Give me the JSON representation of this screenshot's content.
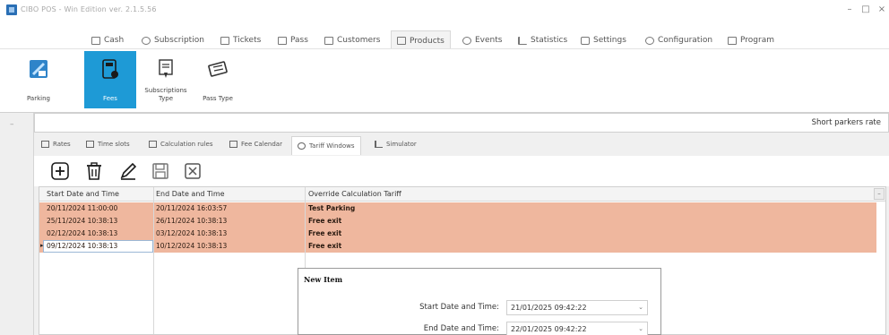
{
  "window": {
    "title": "CIBO POS - Win Edition ver. 2.1.5.56",
    "minimize": "–",
    "restore": "□",
    "close": "×"
  },
  "menu": {
    "items": [
      {
        "label": "Cash",
        "icon": "cash-register-icon"
      },
      {
        "label": "Subscription",
        "icon": "subscription-icon"
      },
      {
        "label": "Tickets",
        "icon": "ticket-icon"
      },
      {
        "label": "Pass",
        "icon": "pass-icon"
      },
      {
        "label": "Customers",
        "icon": "customers-icon"
      },
      {
        "label": "Products",
        "icon": "products-icon",
        "active": true
      },
      {
        "label": "Events",
        "icon": "events-icon"
      },
      {
        "label": "Statistics",
        "icon": "statistics-icon"
      },
      {
        "label": "Settings",
        "icon": "settings-icon"
      },
      {
        "label": "Configuration",
        "icon": "configuration-icon"
      },
      {
        "label": "Program",
        "icon": "program-icon"
      }
    ]
  },
  "ribbon": {
    "parking": "Parking",
    "fees": "Fees",
    "subscriptions_type": "Subscriptions Type",
    "pass_type": "Pass Type"
  },
  "rate": {
    "name": "Short parkers rate"
  },
  "subtabs": {
    "items": [
      {
        "label": "Rates"
      },
      {
        "label": "Time slots"
      },
      {
        "label": "Calculation rules"
      },
      {
        "label": "Fee Calendar"
      },
      {
        "label": "Tariff Windows",
        "active": true
      },
      {
        "label": "Simulator"
      }
    ]
  },
  "toolbar": {
    "add": "add",
    "delete": "delete",
    "edit": "edit",
    "save": "save",
    "cancel": "cancel"
  },
  "grid": {
    "columns": [
      "Start Date and Time",
      "End Date and Time",
      "Override Calculation Tariff"
    ],
    "rows": [
      {
        "start": "20/11/2024 11:00:00",
        "end": "20/11/2024 16:03:57",
        "tariff": "Test Parking"
      },
      {
        "start": "25/11/2024 10:38:13",
        "end": "26/11/2024 10:38:13",
        "tariff": "Free exit"
      },
      {
        "start": "02/12/2024 10:38:13",
        "end": "03/12/2024 10:38:13",
        "tariff": "Free exit"
      },
      {
        "start": "09/12/2024 10:38:13",
        "end": "10/12/2024 10:38:13",
        "tariff": "Free exit"
      }
    ],
    "highlight_color": "#efb79e"
  },
  "popup": {
    "title": "New Item",
    "start_label": "Start Date and Time:",
    "start_value": "21/01/2025 09:42:22",
    "end_label": "End Date and Time:",
    "end_value": "22/01/2025 09:42:22"
  },
  "colors": {
    "accent": "#1e9ad6",
    "row_highlight": "#efb79e"
  }
}
